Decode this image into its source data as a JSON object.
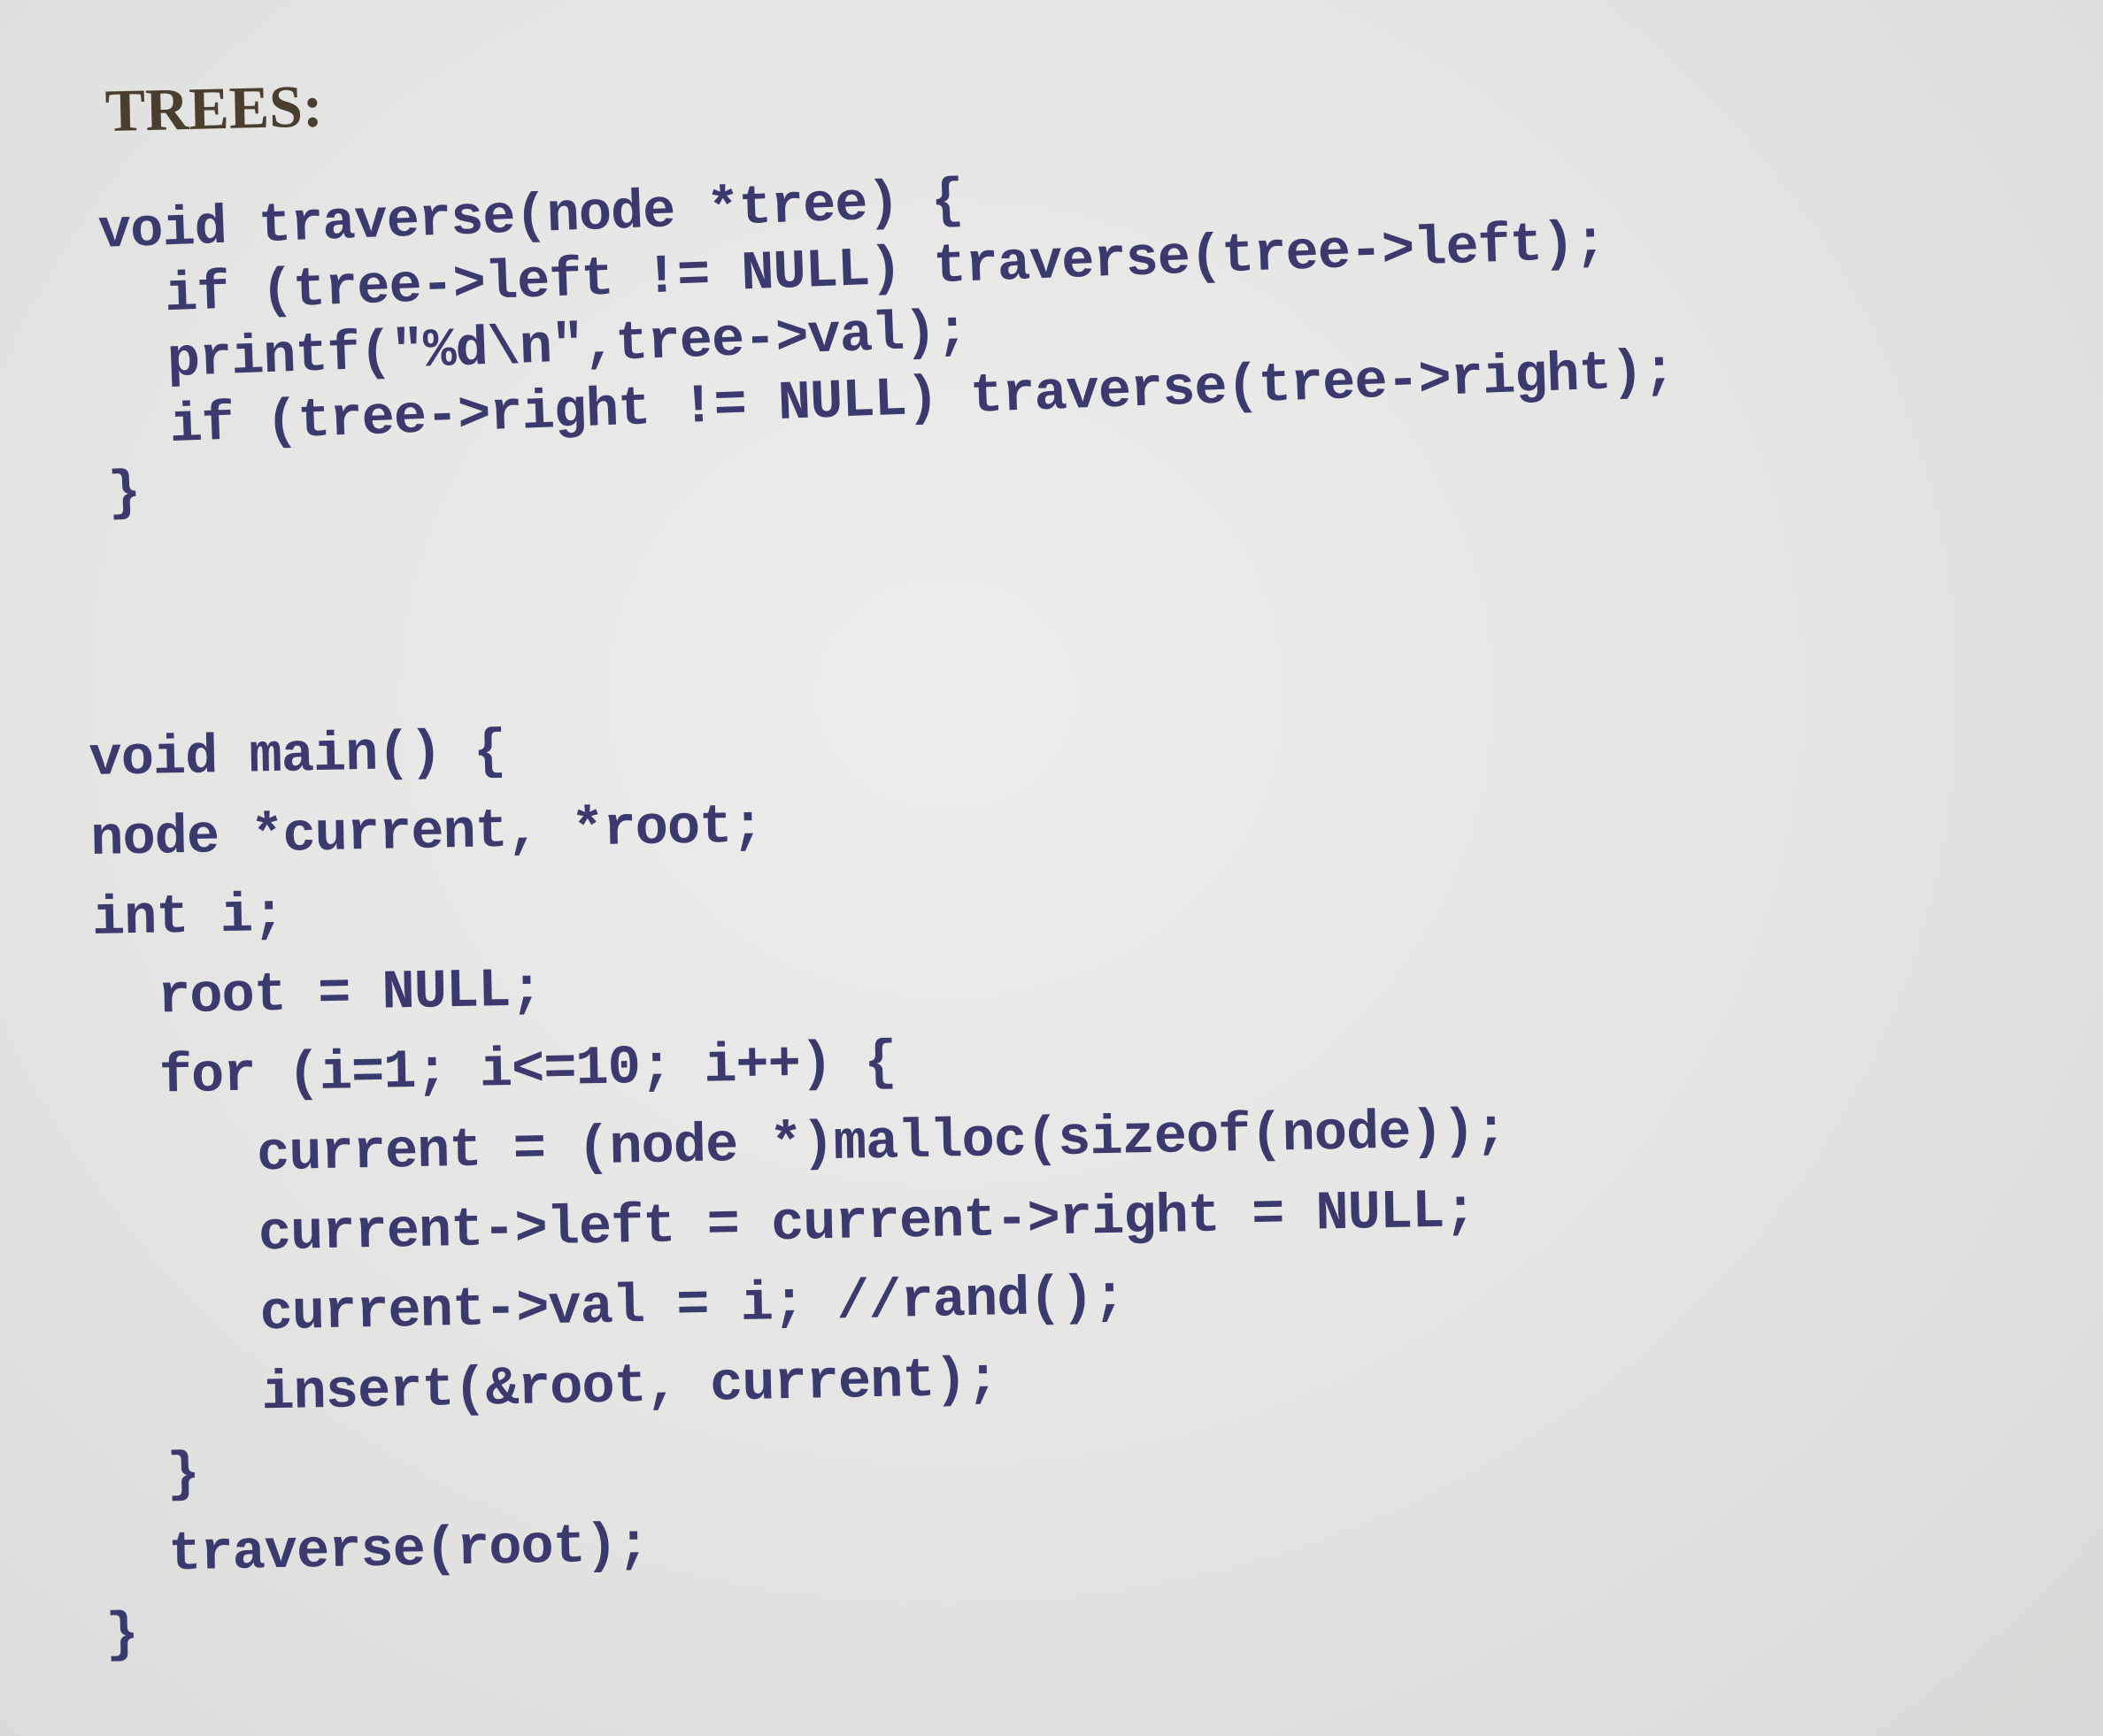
{
  "slide": {
    "heading": "TREES:"
  },
  "traverse_function": {
    "lines": [
      "void traverse(node *tree) {",
      "  if (tree->left != NULL) traverse(tree->left);",
      "  printf(\"%d\\n\",tree->val);",
      "  if (tree->right != NULL) traverse(tree->right);",
      "}"
    ]
  },
  "main_function": {
    "lines": [
      "void main() {",
      "node *current, *root;",
      "int i;",
      "  root = NULL;",
      "  for (i=1; i<=10; i++) {",
      "     current = (node *)malloc(sizeof(node));",
      "     current->left = current->right = NULL;",
      "     current->val = i; //rand();",
      "     insert(&root, current);",
      "  }",
      "  traverse(root);",
      "}"
    ]
  }
}
